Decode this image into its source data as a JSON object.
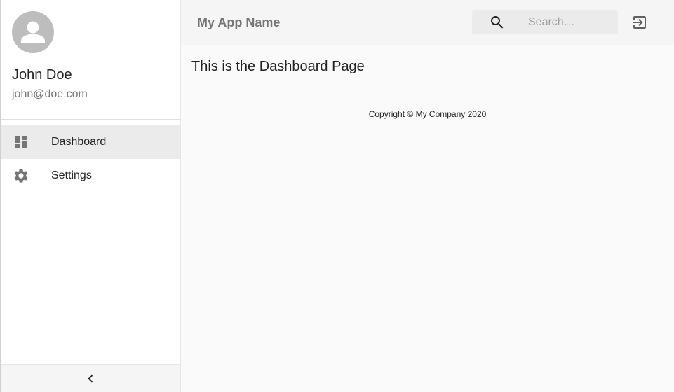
{
  "user": {
    "name": "John Doe",
    "email": "john@doe.com"
  },
  "sidebar": {
    "items": [
      {
        "label": "Dashboard",
        "icon": "dashboard-icon",
        "active": true
      },
      {
        "label": "Settings",
        "icon": "gear-icon",
        "active": false
      }
    ],
    "collapse_icon": "chevron-left-icon"
  },
  "header": {
    "title": "My App Name",
    "search": {
      "placeholder": "Search…",
      "value": ""
    },
    "logout_icon": "logout-icon"
  },
  "main": {
    "heading": "This is the Dashboard Page",
    "copyright": "Copyright © My Company 2020"
  },
  "colors": {
    "sidebar_bg": "#ffffff",
    "header_bg": "#f5f5f5",
    "active_item_bg": "#ebebeb",
    "avatar_bg": "#bdbdbd",
    "muted_text": "#757575"
  }
}
